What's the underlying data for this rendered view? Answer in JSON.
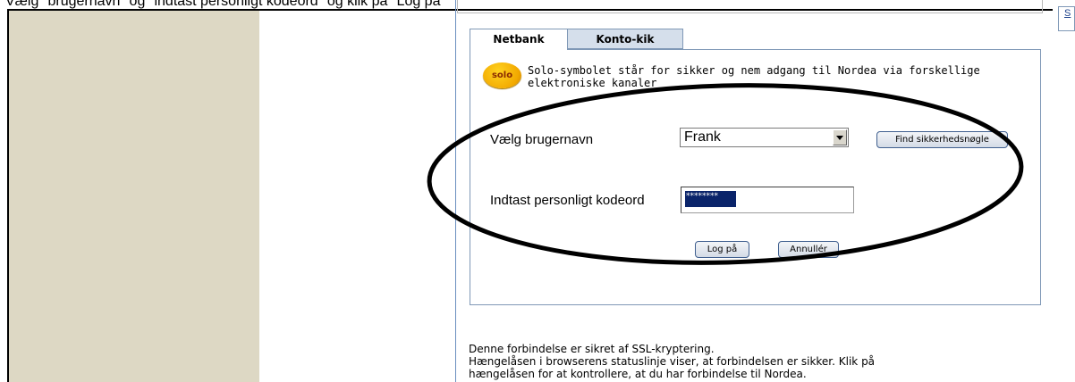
{
  "caption": "Vælg \"brugernavn\" og \"indtast personligt kodeord\" og klik på \"Log på\"",
  "side_link": "S",
  "tabs": [
    {
      "label": "Netbank",
      "active": true
    },
    {
      "label": "Konto-kik",
      "active": false
    }
  ],
  "logo": {
    "text": "solo",
    "color": "#f2a800"
  },
  "intro_text": "Solo-symbolet står for sikker og nem adgang til Nordea via forskellige elektroniske kanaler",
  "login_form": {
    "username_label": "Vælg brugernavn",
    "username_value": "Frank",
    "find_key_button": "Find sikkerhedsnøgle",
    "password_label": "Indtast personligt kodeord",
    "password_value": "********",
    "login_button": "Log på",
    "cancel_button": "Annullér"
  },
  "security_notice": {
    "line1": "Denne forbindelse er sikret af SSL-kryptering.",
    "line2": "Hængelåsen i browserens statuslinje viser, at forbindelsen er sikker. Klik på",
    "line3": "hængelåsen for at kontrollere, at du har forbindelse til Nordea."
  },
  "colors": {
    "sidebar": "#ddd8c4",
    "tab_inactive": "#d5dfeb",
    "panel_border": "#7f98b6",
    "selection": "#0a246a"
  }
}
